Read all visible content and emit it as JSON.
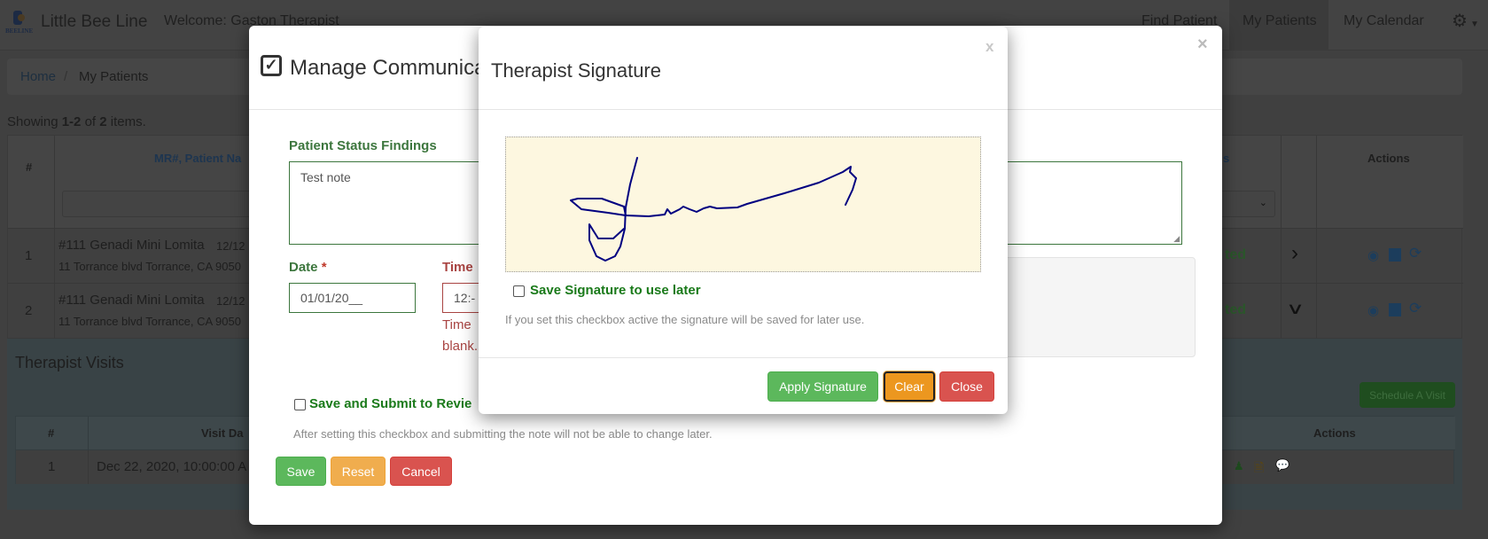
{
  "navbar": {
    "brand": "Little Bee Line",
    "logo_text": "BEELINE",
    "welcome": "Welcome: Gaston Therapist",
    "links": [
      "Find Patient",
      "My Patients",
      "My Calendar"
    ],
    "active_link": "My Patients",
    "settings_icon": "gear-icon"
  },
  "breadcrumb": {
    "home": "Home",
    "separator": "/",
    "current": "My Patients"
  },
  "summary": {
    "prefix": "Showing ",
    "range": "1-2",
    "of": " of ",
    "total": "2",
    "suffix": " items."
  },
  "patients_table": {
    "headers": {
      "num": "#",
      "mr": "MR#, Patient Na",
      "status": "s",
      "actions": "Actions"
    },
    "rows": [
      {
        "num": "1",
        "name": "#111 Genadi Mini Lomita",
        "date": "12/12",
        "address": "11 Torrance blvd Torrance, CA 9050",
        "status": "ted",
        "expand": "collapsed"
      },
      {
        "num": "2",
        "name": "#111 Genadi Mini Lomita",
        "date": "12/12",
        "address": "11 Torrance blvd Torrance, CA 9050",
        "status": "ted",
        "expand": "expanded"
      }
    ]
  },
  "visits": {
    "title": "Therapist Visits",
    "schedule_button": "Schedule A Visit",
    "headers": {
      "num": "#",
      "date": "Visit Da",
      "actions": "Actions"
    },
    "rows": [
      {
        "num": "1",
        "date": "Dec 22, 2020, 10:00:00 A"
      }
    ]
  },
  "manage_modal": {
    "title": "Manage Communica",
    "close": "×",
    "findings_label": "Patient Status Findings",
    "findings_value": "Test note",
    "date_label": "Date",
    "required_mark": "*",
    "date_value": "01/01/20__",
    "time_label": "Time",
    "time_value": "12:-",
    "time_error_1": "Time",
    "time_error_2": "blank.",
    "submit_label": "Save and Submit to Revie",
    "submit_help": "After setting this checkbox and submitting the note will not be able to change later.",
    "buttons": {
      "save": "Save",
      "reset": "Reset",
      "cancel": "Cancel"
    }
  },
  "signature_modal": {
    "title": "Therapist Signature",
    "close": "x",
    "save_label": "Save Signature to use later",
    "save_help": "If you set this checkbox active the signature will be saved for later use.",
    "buttons": {
      "apply": "Apply Signature",
      "clear": "Clear",
      "close": "Close"
    }
  },
  "colors": {
    "success": "#5cb85c",
    "warning": "#f0ad4e",
    "danger": "#d9534f",
    "label_green": "#3c763d",
    "signature_ink": "#000080",
    "pad_bg": "#fdf7e0"
  }
}
